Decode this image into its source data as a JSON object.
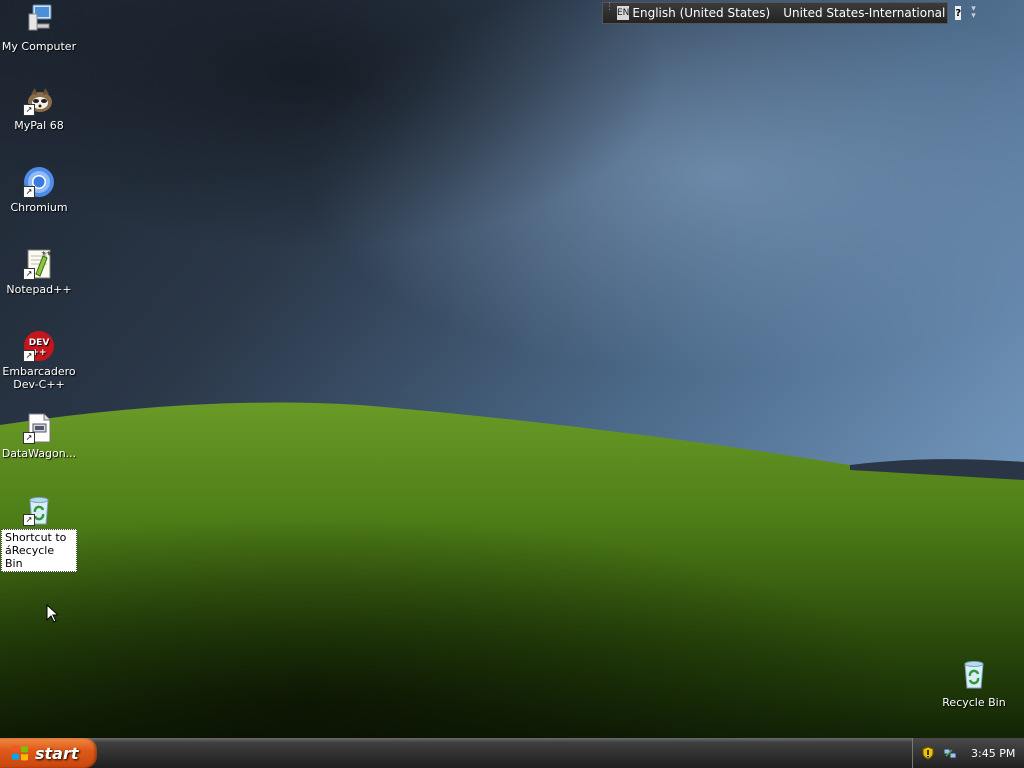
{
  "language_bar": {
    "language_code": "EN",
    "language": "English (United States)",
    "keyboard_layout": "United States-International",
    "help_label": "?"
  },
  "desktop_icons": [
    {
      "label": "My Computer",
      "icon": "my-computer-icon",
      "shortcut": false
    },
    {
      "label": "MyPal 68",
      "icon": "mypal-icon",
      "shortcut": true
    },
    {
      "label": "Chromium",
      "icon": "chromium-icon",
      "shortcut": true
    },
    {
      "label": "Notepad++",
      "icon": "notepad-plus-plus-icon",
      "shortcut": true
    },
    {
      "label": "Embarcadero Dev-C++",
      "icon": "dev-cpp-icon",
      "shortcut": true
    },
    {
      "label": "DataWagon...",
      "icon": "datawagon-icon",
      "shortcut": true
    },
    {
      "label": "Shortcut to áRecycle Bin",
      "icon": "recycle-bin-icon",
      "shortcut": true,
      "selected": true
    }
  ],
  "recycle_bin": {
    "label": "Recycle Bin"
  },
  "taskbar": {
    "start_label": "start",
    "clock": "3:45 PM"
  },
  "colors": {
    "start_button": "#e05a19",
    "taskbar": "#2e2e2e",
    "sky": "#2a3a4e",
    "grass": "#4f7f1a"
  }
}
